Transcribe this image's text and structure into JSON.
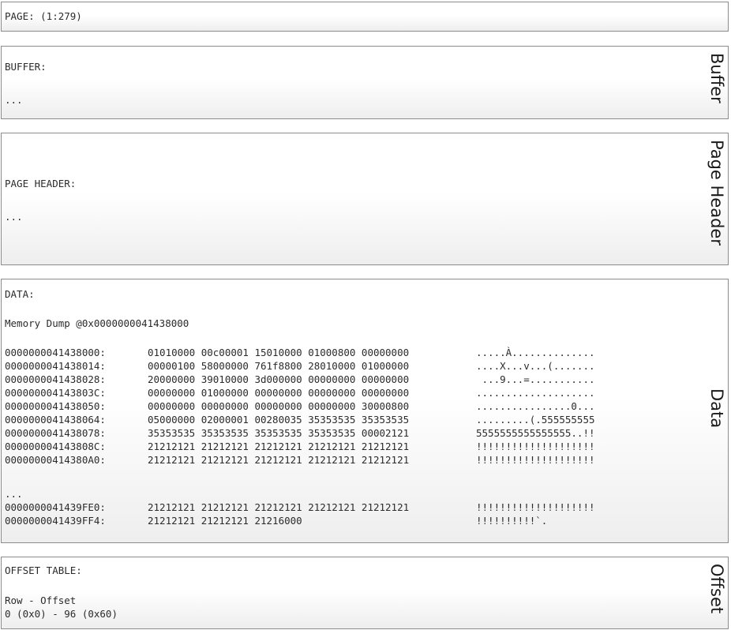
{
  "page_panel": {
    "label": "PAGE: (1:279)"
  },
  "buffer_panel": {
    "heading": "BUFFER:",
    "body": "...",
    "side_title": "Buffer"
  },
  "header_panel": {
    "heading": "PAGE HEADER:",
    "body": "...",
    "side_title": "Page Header"
  },
  "data_panel": {
    "heading": "DATA:",
    "memory_dump_label": "Memory Dump @0x0000000041438000",
    "side_title": "Data",
    "rows_top": [
      {
        "addr": "0000000041438000:",
        "hex": "01010000 00c00001 15010000 01000800 00000000",
        "ascii": ".....À.............."
      },
      {
        "addr": "0000000041438014:",
        "hex": "00000100 58000000 761f8800 28010000 01000000",
        "ascii": "....X...v...(......."
      },
      {
        "addr": "0000000041438028:",
        "hex": "20000000 39010000 3d000000 00000000 00000000",
        "ascii": " ...9...=..........."
      },
      {
        "addr": "000000004143803C:",
        "hex": "00000000 01000000 00000000 00000000 00000000",
        "ascii": "...................."
      },
      {
        "addr": "0000000041438050:",
        "hex": "00000000 00000000 00000000 00000000 30000800",
        "ascii": "................0..."
      },
      {
        "addr": "0000000041438064:",
        "hex": "05000000 02000001 00280035 35353535 35353535",
        "ascii": ".........(.555555555"
      },
      {
        "addr": "0000000041438078:",
        "hex": "35353535 35353535 35353535 35353535 00002121",
        "ascii": "5555555555555555..!!"
      },
      {
        "addr": "000000004143808C:",
        "hex": "21212121 21212121 21212121 21212121 21212121",
        "ascii": "!!!!!!!!!!!!!!!!!!!!"
      },
      {
        "addr": "00000000414380A0:",
        "hex": "21212121 21212121 21212121 21212121 21212121",
        "ascii": "!!!!!!!!!!!!!!!!!!!!"
      }
    ],
    "ellipsis": "...",
    "rows_bottom": [
      {
        "addr": "0000000041439FE0:",
        "hex": "21212121 21212121 21212121 21212121 21212121",
        "ascii": "!!!!!!!!!!!!!!!!!!!!"
      },
      {
        "addr": "0000000041439FF4:",
        "hex": "21212121 21212121 21216000",
        "ascii": "!!!!!!!!!!`."
      }
    ]
  },
  "offset_panel": {
    "heading": "OFFSET TABLE:",
    "column_header": "Row - Offset",
    "entry": "0 (0x0) - 96 (0x60)",
    "side_title": "Offset"
  }
}
